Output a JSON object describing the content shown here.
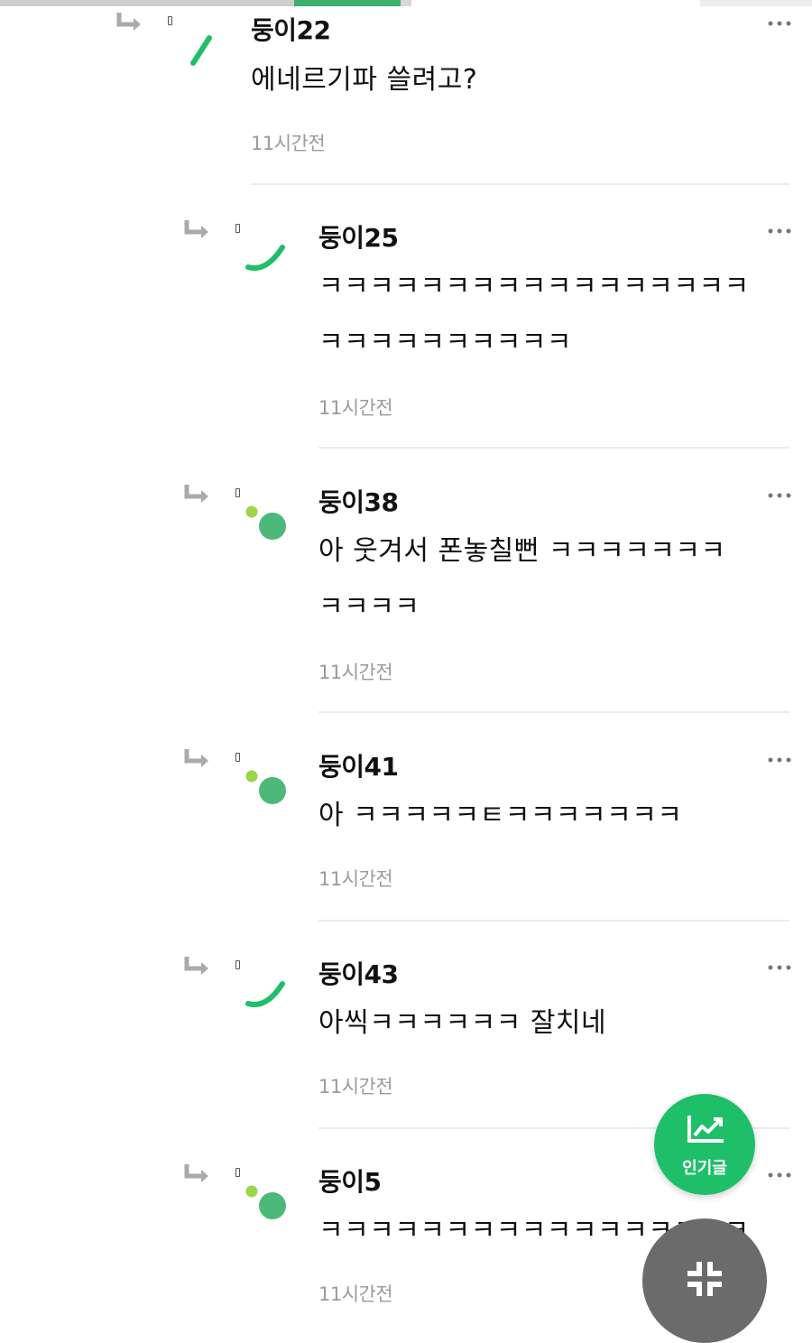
{
  "comments": [
    {
      "author": "둥이22",
      "text": "에네르기파 쓸려고?",
      "time": "11시간전"
    },
    {
      "author": "둥이25",
      "text": "ㅋㅋㅋㅋㅋㅋㅋㅋㅋㅋㅋㅋㅋㅋㅋㅋㅋ\nㅋㅋㅋㅋㅋㅋㅋㅋㅋㅋ",
      "time": "11시간전"
    },
    {
      "author": "둥이38",
      "text": "아 웃겨서 폰놓칠뻔 ㅋㅋㅋㅋㅋㅋㅋ\nㅋㅋㅋㅋ",
      "time": "11시간전"
    },
    {
      "author": "둥이41",
      "text": "아 ㅋㅋㅋㅋㅋㅌㅋㅋㅋㅋㅋㅋㅋ",
      "time": "11시간전"
    },
    {
      "author": "둥이43",
      "text": "아씩ㅋㅋㅋㅋㅋㅋ 잘치네",
      "time": "11시간전"
    },
    {
      "author": "둥이5",
      "text": "ㅋㅋㅋㅋㅋㅋㅋㅋㅋㅋㅋㅋㅋㅋㅋㅋㅋ",
      "time": "11시간전"
    }
  ],
  "fab": {
    "popular_label": "인기글",
    "popular_icon": "trending-chart-icon",
    "collapse_icon": "collapse-arrows-icon"
  },
  "colors": {
    "accent": "#1fbf6a",
    "timestamp": "#9b9b9b",
    "divider": "#ececec",
    "avatar_green": "#4cb87a",
    "avatar_lime": "#9ad54a"
  }
}
